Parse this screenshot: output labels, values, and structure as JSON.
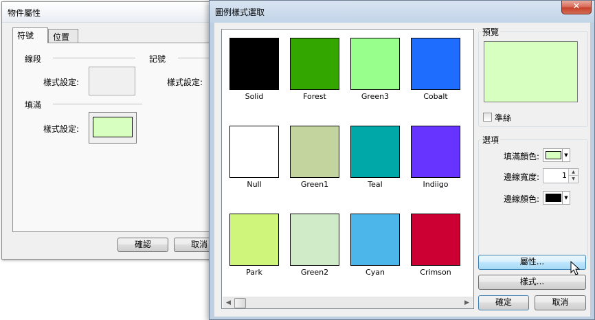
{
  "bg_dialog": {
    "title": "物件屬性",
    "tabs": [
      "符號",
      "位置"
    ],
    "line_section": "線段",
    "marker_section": "記號",
    "fill_section": "填滿",
    "style_label": "樣式設定:",
    "fill_color": "#d6ffc0",
    "ok_label": "確認",
    "cancel_label": "取消"
  },
  "fg_dialog": {
    "title": "圖例樣式選取",
    "close_label": "✕",
    "swatches": [
      {
        "name": "Solid",
        "color": "#000000"
      },
      {
        "name": "Forest",
        "color": "#33a600"
      },
      {
        "name": "Green3",
        "color": "#99ff8c"
      },
      {
        "name": "Cobalt",
        "color": "#1f6dff"
      },
      {
        "name": "Null",
        "color": "#ffffff"
      },
      {
        "name": "Green1",
        "color": "#c4d49e"
      },
      {
        "name": "Teal",
        "color": "#00a8a8"
      },
      {
        "name": "Indiigo",
        "color": "#6633ff"
      },
      {
        "name": "Park",
        "color": "#cff57a"
      },
      {
        "name": "Green2",
        "color": "#cfebc8"
      },
      {
        "name": "Cyan",
        "color": "#4cb6ea"
      },
      {
        "name": "Crimson",
        "color": "#cc0033"
      }
    ],
    "preview": {
      "title": "預覽",
      "color": "#d6ffc0",
      "baseline_label": "準絲"
    },
    "options": {
      "title": "選項",
      "fill_color_label": "填滿顏色:",
      "fill_color": "#d6ffc0",
      "border_width_label": "邊線寬度:",
      "border_width": "1",
      "border_color_label": "邊線顏色:",
      "border_color": "#000000"
    },
    "buttons": {
      "properties": "屬性...",
      "style": "樣式...",
      "ok": "確定",
      "cancel": "取消"
    }
  }
}
